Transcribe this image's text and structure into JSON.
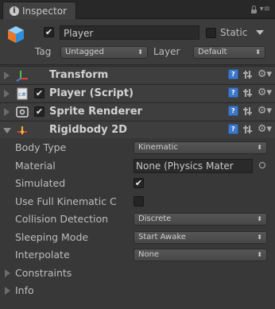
{
  "window": {
    "tab_label": "Inspector",
    "tab_icon": "info-icon"
  },
  "header": {
    "active": true,
    "name": "Player",
    "static_label": "Static",
    "static_checked": false,
    "tag_label": "Tag",
    "tag_value": "Untagged",
    "layer_label": "Layer",
    "layer_value": "Default"
  },
  "components": [
    {
      "title": "Transform",
      "icon": "transform-icon",
      "expanded": false,
      "has_checkbox": false
    },
    {
      "title": "Player (Script)",
      "icon": "script-icon",
      "expanded": false,
      "has_checkbox": true,
      "enabled": true
    },
    {
      "title": "Sprite Renderer",
      "icon": "sprite-renderer-icon",
      "expanded": false,
      "has_checkbox": true,
      "enabled": true
    },
    {
      "title": "Rigidbody 2D",
      "icon": "rigidbody2d-icon",
      "expanded": true,
      "has_checkbox": false
    }
  ],
  "rigidbody": {
    "body_type_label": "Body Type",
    "body_type_value": "Kinematic",
    "material_label": "Material",
    "material_value": "None (Physics Mater",
    "simulated_label": "Simulated",
    "simulated_checked": true,
    "full_kinematic_label": "Use Full Kinematic C",
    "full_kinematic_checked": false,
    "collision_detection_label": "Collision Detection",
    "collision_detection_value": "Discrete",
    "sleeping_mode_label": "Sleeping Mode",
    "sleeping_mode_value": "Start Awake",
    "interpolate_label": "Interpolate",
    "interpolate_value": "None",
    "constraints_label": "Constraints",
    "info_label": "Info"
  },
  "colors": {
    "background": "#383838",
    "accent_blue": "#3f78c8"
  }
}
